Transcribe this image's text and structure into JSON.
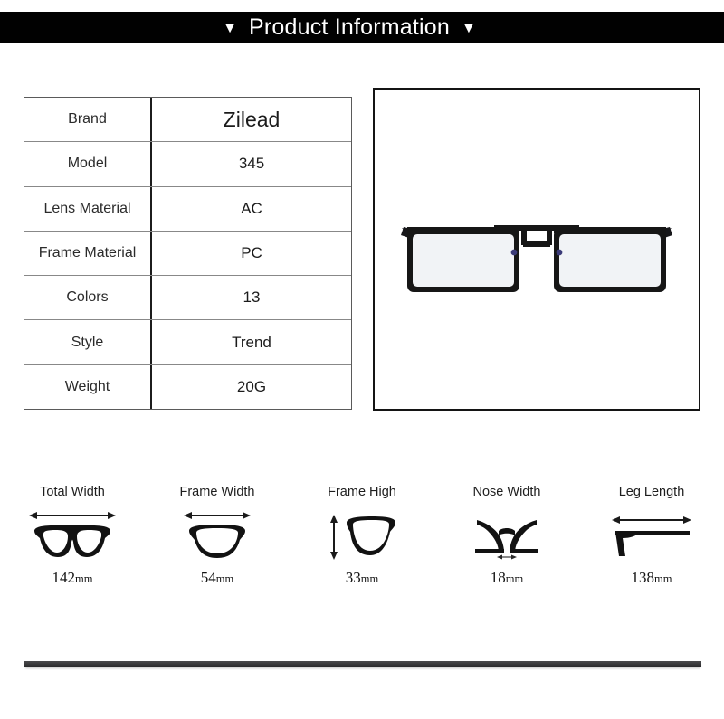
{
  "header": {
    "title": "Product Information",
    "left_marker": "▼",
    "right_marker": "▼",
    "background_color": "#010101",
    "text_color": "#ffffff"
  },
  "spec_table": {
    "rows": [
      {
        "key": "Brand",
        "value": "Zilead"
      },
      {
        "key": "Model",
        "value": "345"
      },
      {
        "key": "Lens Material",
        "value": "AC"
      },
      {
        "key": "Frame Material",
        "value": "PC"
      },
      {
        "key": "Colors",
        "value": "13"
      },
      {
        "key": "Style",
        "value": "Trend"
      },
      {
        "key": "Weight",
        "value": "20G"
      }
    ]
  },
  "product_photo": {
    "alt": "black rectangular metal eyeglasses frame with blue temple arms, front view",
    "frame_color": "#161616",
    "temple_color": "#4a4a8c",
    "lens_color": "#f2f4f6"
  },
  "measurements": [
    {
      "label": "Total Width",
      "value": "142",
      "unit": "mm",
      "icon": "full-glasses-width-icon"
    },
    {
      "label": "Frame Width",
      "value": "54",
      "unit": "mm",
      "icon": "single-lens-width-icon"
    },
    {
      "label": "Frame High",
      "value": "33",
      "unit": "mm",
      "icon": "single-lens-height-icon"
    },
    {
      "label": "Nose Width",
      "value": "18",
      "unit": "mm",
      "icon": "nose-bridge-icon"
    },
    {
      "label": "Leg Length",
      "value": "138",
      "unit": "mm",
      "icon": "temple-arm-icon"
    }
  ],
  "divider": {
    "color": "#3b3b3d"
  }
}
